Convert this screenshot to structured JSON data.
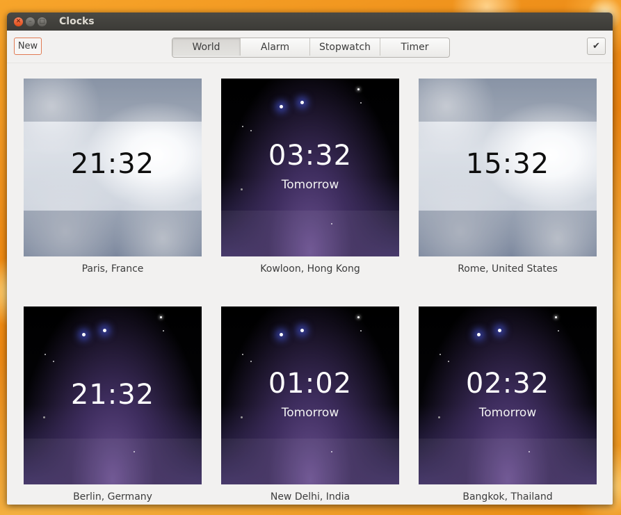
{
  "window": {
    "title": "Clocks"
  },
  "toolbar": {
    "new_label": "New",
    "tabs": [
      {
        "label": "World",
        "active": true
      },
      {
        "label": "Alarm",
        "active": false
      },
      {
        "label": "Stopwatch",
        "active": false
      },
      {
        "label": "Timer",
        "active": false
      }
    ],
    "select_icon": "checkmark-icon"
  },
  "clocks": [
    {
      "time": "21:32",
      "day": "",
      "location": "Paris, France",
      "theme": "day"
    },
    {
      "time": "03:32",
      "day": "Tomorrow",
      "location": "Kowloon, Hong Kong",
      "theme": "night"
    },
    {
      "time": "15:32",
      "day": "",
      "location": "Rome, United States",
      "theme": "day"
    },
    {
      "time": "21:32",
      "day": "",
      "location": "Berlin, Germany",
      "theme": "night"
    },
    {
      "time": "01:02",
      "day": "Tomorrow",
      "location": "New Delhi, India",
      "theme": "night"
    },
    {
      "time": "02:32",
      "day": "Tomorrow",
      "location": "Bangkok, Thailand",
      "theme": "night"
    }
  ]
}
